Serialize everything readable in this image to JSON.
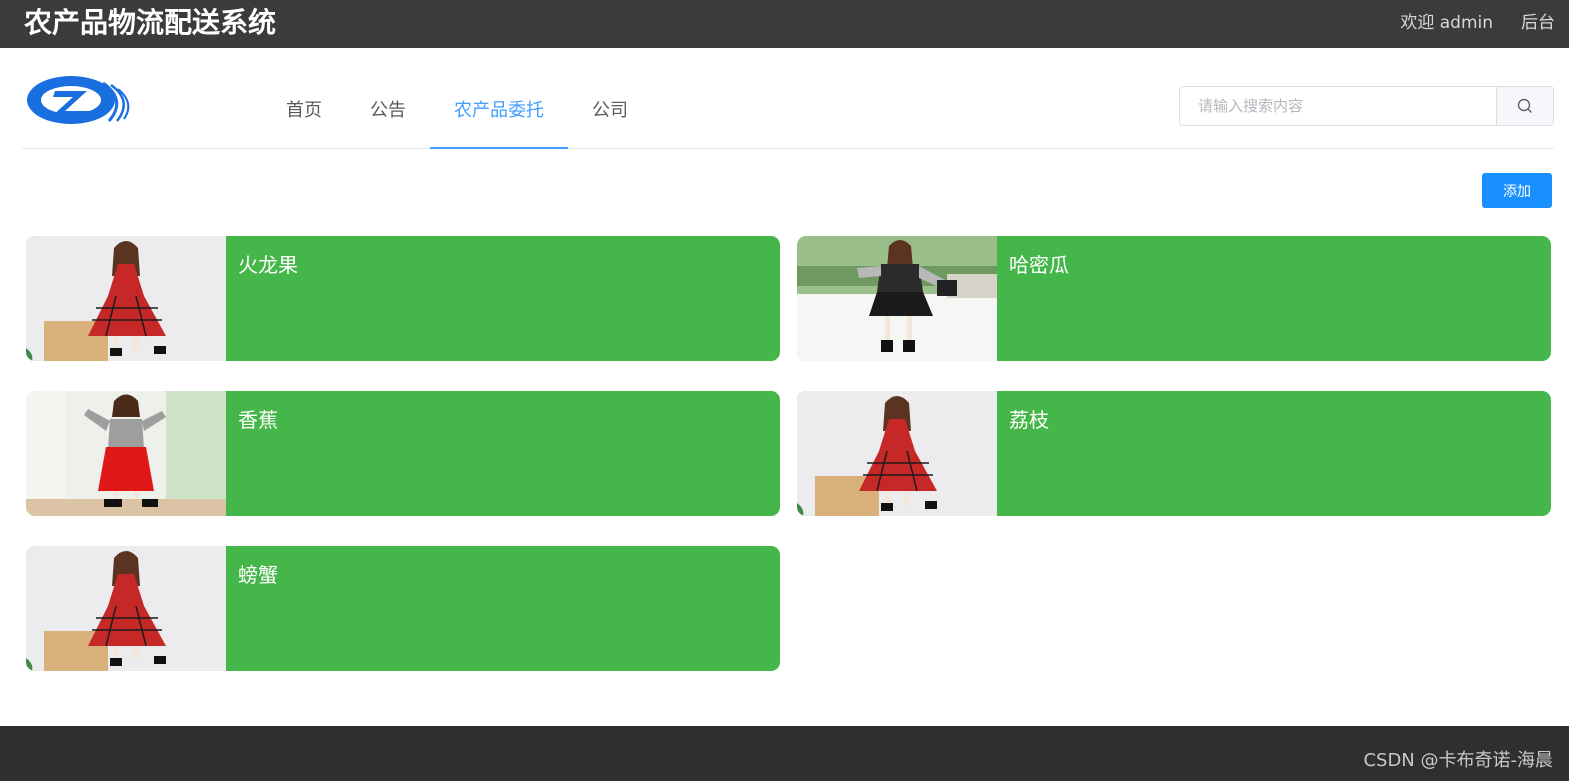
{
  "topbar": {
    "title": "农产品物流配送系统",
    "welcome": "欢迎 admin",
    "backend_link": "后台"
  },
  "nav": {
    "items": [
      {
        "label": "首页"
      },
      {
        "label": "公告"
      },
      {
        "label": "农产品委托",
        "active": true
      },
      {
        "label": "公司"
      }
    ]
  },
  "search": {
    "placeholder": "请输入搜索内容",
    "icon": "search-icon"
  },
  "actions": {
    "add_label": "添加"
  },
  "products": [
    {
      "name": "火龙果",
      "image": "girl-red-plaid-dress"
    },
    {
      "name": "哈密瓜",
      "image": "girl-black-dress-outdoor"
    },
    {
      "name": "香蕉",
      "image": "girl-red-skirt"
    },
    {
      "name": "荔枝",
      "image": "girl-red-plaid-dress"
    },
    {
      "name": "螃蟹",
      "image": "girl-red-plaid-dress"
    }
  ],
  "footer": {
    "watermark": "CSDN @卡布奇诺-海晨"
  },
  "colors": {
    "topbar_bg": "#3b3b3b",
    "accent": "#409eff",
    "card_bg": "#45b649",
    "add_button": "#1890ff",
    "footer_bg": "#2f2f2f"
  }
}
